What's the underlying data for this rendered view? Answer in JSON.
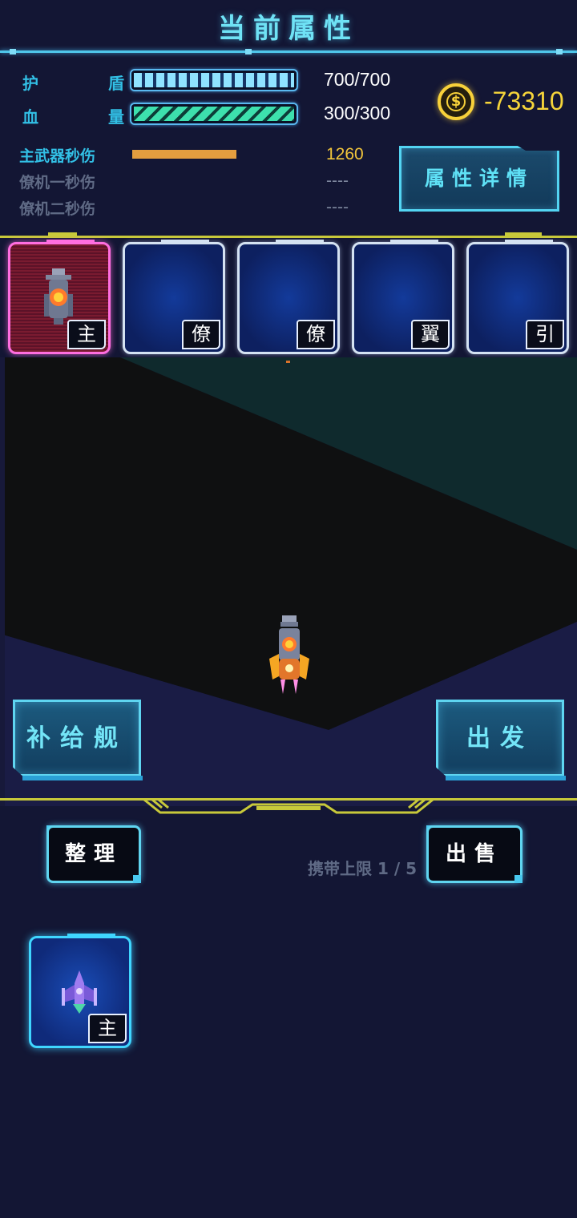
{
  "header": {
    "title": "当前属性"
  },
  "stats": {
    "shield": {
      "label": "护 盾",
      "value": "700/700",
      "ratio": 1.0
    },
    "hp": {
      "label": "血 量",
      "value": "300/300",
      "ratio": 1.0
    },
    "gold": "-73310"
  },
  "dps": [
    {
      "label": "主武器秒伤",
      "value": "1260",
      "color": "#32c0e6",
      "value_color": "#f3c63b",
      "ratio": 0.5
    },
    {
      "label": "僚机一秒伤",
      "value": "----",
      "color": "#5f6a85",
      "value_color": "#7c859c",
      "ratio": 0
    },
    {
      "label": "僚机二秒伤",
      "value": "----",
      "color": "#5f6a85",
      "value_color": "#7c859c",
      "ratio": 0
    }
  ],
  "buttons": {
    "detail": "属性详情",
    "supply": "补给舰",
    "depart": "出发",
    "sort": "整理",
    "sell": "出售"
  },
  "slots": [
    {
      "tag": "主",
      "type": "main",
      "filled": true
    },
    {
      "tag": "僚",
      "type": "wingman",
      "filled": false
    },
    {
      "tag": "僚",
      "type": "wingman",
      "filled": false
    },
    {
      "tag": "翼",
      "type": "wing",
      "filled": false
    },
    {
      "tag": "引",
      "type": "engine",
      "filled": false
    }
  ],
  "inventory": {
    "limit_text": "携带上限 1 / 5",
    "items": [
      {
        "tag": "主",
        "icon": "purple-fighter-icon"
      }
    ]
  },
  "colors": {
    "accent": "#5fd5f0",
    "gold": "#f6d53a",
    "divider": "#c8c93a"
  }
}
